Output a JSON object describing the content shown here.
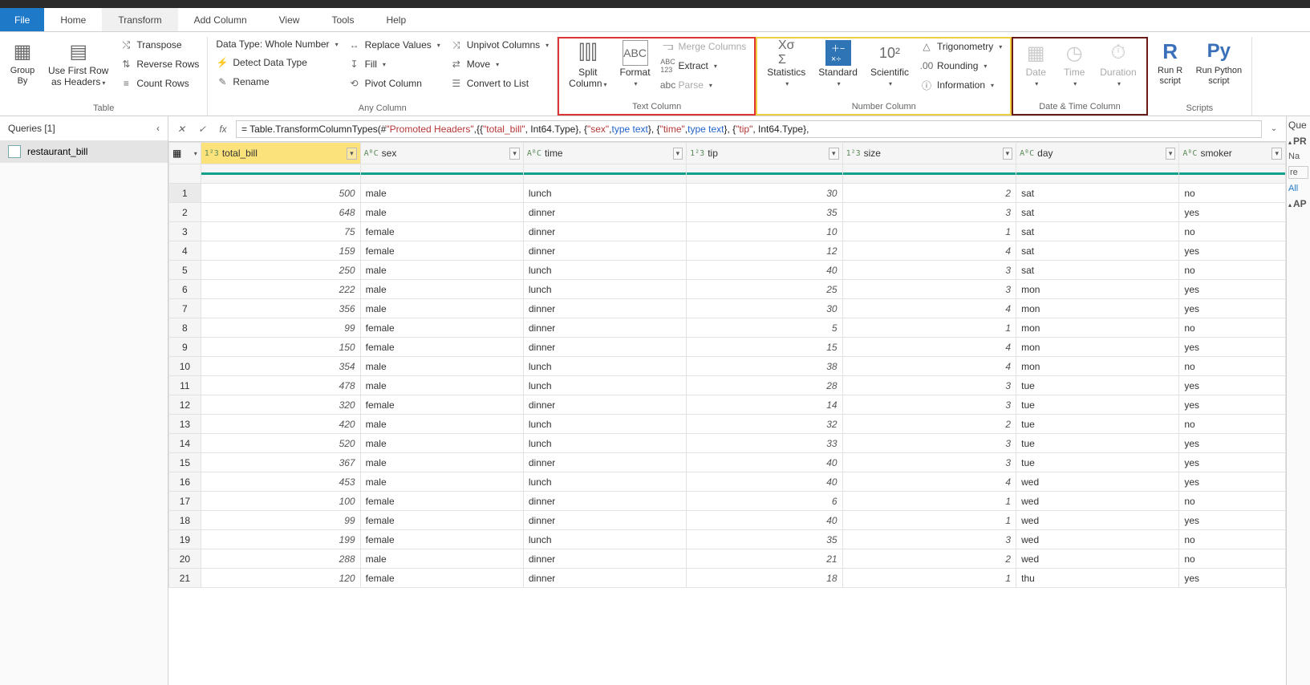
{
  "tabs": {
    "file": "File",
    "home": "Home",
    "transform": "Transform",
    "addcol": "Add Column",
    "view": "View",
    "tools": "Tools",
    "help": "Help"
  },
  "ribbon": {
    "table": {
      "groupby": "Group\nBy",
      "firstrow": "Use First Row\nas Headers",
      "transpose": "Transpose",
      "reverse": "Reverse Rows",
      "count": "Count Rows",
      "label": "Table"
    },
    "anycol": {
      "datatype": "Data Type: Whole Number",
      "detect": "Detect Data Type",
      "rename": "Rename",
      "replace": "Replace Values",
      "fill": "Fill",
      "pivot": "Pivot Column",
      "unpivot": "Unpivot Columns",
      "move": "Move",
      "convert": "Convert to List",
      "label": "Any Column"
    },
    "textcol": {
      "split": "Split\nColumn",
      "format": "Format",
      "merge": "Merge Columns",
      "extract": "Extract",
      "parse": "Parse",
      "label": "Text Column"
    },
    "numcol": {
      "stats": "Statistics",
      "standard": "Standard",
      "scientific": "Scientific",
      "trig": "Trigonometry",
      "round": "Rounding",
      "info": "Information",
      "label": "Number Column"
    },
    "datetimecol": {
      "date": "Date",
      "time": "Time",
      "duration": "Duration",
      "label": "Date & Time Column"
    },
    "scripts": {
      "r": "Run R\nscript",
      "py": "Run Python\nscript",
      "label": "Scripts"
    }
  },
  "queries": {
    "header": "Queries [1]",
    "item": "restaurant_bill"
  },
  "formula": {
    "p1": "= Table.TransformColumnTypes(#",
    "t1": "\"Promoted Headers\"",
    "p2": ",{{",
    "t2": "\"total_bill\"",
    "p3": ", Int64.Type}, {",
    "t3": "\"sex\"",
    "p4": ", ",
    "k1": "type text",
    "p5": "}, {",
    "t4": "\"time\"",
    "p6": ", ",
    "k2": "type text",
    "p7": "}, {",
    "t5": "\"tip\"",
    "p8": ", Int64.Type},"
  },
  "columns": [
    {
      "name": "total_bill",
      "type": "num"
    },
    {
      "name": "sex",
      "type": "text"
    },
    {
      "name": "time",
      "type": "text"
    },
    {
      "name": "tip",
      "type": "num"
    },
    {
      "name": "size",
      "type": "num"
    },
    {
      "name": "day",
      "type": "text"
    },
    {
      "name": "smoker",
      "type": "text"
    }
  ],
  "rows": [
    {
      "total_bill": 500,
      "sex": "male",
      "time": "lunch",
      "tip": 30,
      "size": 2,
      "day": "sat",
      "smoker": "no"
    },
    {
      "total_bill": 648,
      "sex": "male",
      "time": "dinner",
      "tip": 35,
      "size": 3,
      "day": "sat",
      "smoker": "yes"
    },
    {
      "total_bill": 75,
      "sex": "female",
      "time": "dinner",
      "tip": 10,
      "size": 1,
      "day": "sat",
      "smoker": "no"
    },
    {
      "total_bill": 159,
      "sex": "female",
      "time": "dinner",
      "tip": 12,
      "size": 4,
      "day": "sat",
      "smoker": "yes"
    },
    {
      "total_bill": 250,
      "sex": "male",
      "time": "lunch",
      "tip": 40,
      "size": 3,
      "day": "sat",
      "smoker": "no"
    },
    {
      "total_bill": 222,
      "sex": "male",
      "time": "lunch",
      "tip": 25,
      "size": 3,
      "day": "mon",
      "smoker": "yes"
    },
    {
      "total_bill": 356,
      "sex": "male",
      "time": "dinner",
      "tip": 30,
      "size": 4,
      "day": "mon",
      "smoker": "yes"
    },
    {
      "total_bill": 99,
      "sex": "female",
      "time": "dinner",
      "tip": 5,
      "size": 1,
      "day": "mon",
      "smoker": "no"
    },
    {
      "total_bill": 150,
      "sex": "female",
      "time": "dinner",
      "tip": 15,
      "size": 4,
      "day": "mon",
      "smoker": "yes"
    },
    {
      "total_bill": 354,
      "sex": "male",
      "time": "lunch",
      "tip": 38,
      "size": 4,
      "day": "mon",
      "smoker": "no"
    },
    {
      "total_bill": 478,
      "sex": "male",
      "time": "lunch",
      "tip": 28,
      "size": 3,
      "day": "tue",
      "smoker": "yes"
    },
    {
      "total_bill": 320,
      "sex": "female",
      "time": "dinner",
      "tip": 14,
      "size": 3,
      "day": "tue",
      "smoker": "yes"
    },
    {
      "total_bill": 420,
      "sex": "male",
      "time": "lunch",
      "tip": 32,
      "size": 2,
      "day": "tue",
      "smoker": "no"
    },
    {
      "total_bill": 520,
      "sex": "male",
      "time": "lunch",
      "tip": 33,
      "size": 3,
      "day": "tue",
      "smoker": "yes"
    },
    {
      "total_bill": 367,
      "sex": "male",
      "time": "dinner",
      "tip": 40,
      "size": 3,
      "day": "tue",
      "smoker": "yes"
    },
    {
      "total_bill": 453,
      "sex": "male",
      "time": "lunch",
      "tip": 40,
      "size": 4,
      "day": "wed",
      "smoker": "yes"
    },
    {
      "total_bill": 100,
      "sex": "female",
      "time": "dinner",
      "tip": 6,
      "size": 1,
      "day": "wed",
      "smoker": "no"
    },
    {
      "total_bill": 99,
      "sex": "female",
      "time": "dinner",
      "tip": 40,
      "size": 1,
      "day": "wed",
      "smoker": "yes"
    },
    {
      "total_bill": 199,
      "sex": "female",
      "time": "lunch",
      "tip": 35,
      "size": 3,
      "day": "wed",
      "smoker": "no"
    },
    {
      "total_bill": 288,
      "sex": "male",
      "time": "dinner",
      "tip": 21,
      "size": 2,
      "day": "wed",
      "smoker": "no"
    },
    {
      "total_bill": 120,
      "sex": "female",
      "time": "dinner",
      "tip": 18,
      "size": 1,
      "day": "thu",
      "smoker": "yes"
    }
  ],
  "right": {
    "q": "Que",
    "pr": "PR",
    "na": "Na",
    "re": "re",
    "all": "All",
    "ap": "AP"
  }
}
